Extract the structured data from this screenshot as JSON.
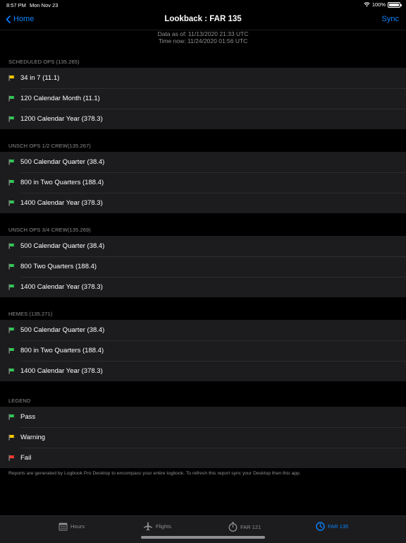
{
  "status": {
    "time": "8:57 PM",
    "date": "Mon Nov 23",
    "battery": "100%"
  },
  "nav": {
    "back_label": "Home",
    "title": "Lookback : FAR 135",
    "sync_label": "Sync"
  },
  "info": {
    "data_as_of": "Data as of: 11/13/2020 21:33 UTC",
    "time_now": "Time now: 11/24/2020 01:56 UTC"
  },
  "colors": {
    "pass": "#34c759",
    "warning": "#ffcc00",
    "fail": "#ff3b30",
    "accent": "#0a84ff"
  },
  "sections": [
    {
      "header": "SCHEDULED OPS (135.265)",
      "rows": [
        {
          "label": "34 in 7 (11.1)",
          "status": "warning"
        },
        {
          "label": "120 Calendar Month (11.1)",
          "status": "pass"
        },
        {
          "label": "1200 Calendar Year (378.3)",
          "status": "pass"
        }
      ]
    },
    {
      "header": "UNSCH OPS 1/2 CREW(135.267)",
      "rows": [
        {
          "label": "500 Calendar Quarter (38.4)",
          "status": "pass"
        },
        {
          "label": "800 in Two Quarters (188.4)",
          "status": "pass"
        },
        {
          "label": "1400 Calendar Year (378.3)",
          "status": "pass"
        }
      ]
    },
    {
      "header": "UNSCH OPS 3/4 CREW(135.269)",
      "rows": [
        {
          "label": "500 Calendar Quarter (38.4)",
          "status": "pass"
        },
        {
          "label": "800 Two Quarters (188.4)",
          "status": "pass"
        },
        {
          "label": "1400 Calendar Year (378.3)",
          "status": "pass"
        }
      ]
    },
    {
      "header": "HEMES (135.271)",
      "rows": [
        {
          "label": "500 Calendar Quarter (38.4)",
          "status": "pass"
        },
        {
          "label": "800 in Two Quarters (188.4)",
          "status": "pass"
        },
        {
          "label": "1400 Calendar Year (378.3)",
          "status": "pass"
        }
      ]
    },
    {
      "header": "LEGEND",
      "rows": [
        {
          "label": "Pass",
          "status": "pass"
        },
        {
          "label": "Warning",
          "status": "warning"
        },
        {
          "label": "Fail",
          "status": "fail"
        }
      ]
    }
  ],
  "footnote": "Reports are generated by Logbook Pro Desktop to encompass your entire logbook. To refresh this report sync your Desktop then this app.",
  "tabs": [
    {
      "label": "Hours",
      "icon": "calendar-icon",
      "active": false
    },
    {
      "label": "Flights",
      "icon": "airplane-icon",
      "active": false
    },
    {
      "label": "FAR 121",
      "icon": "stopwatch-icon",
      "active": false
    },
    {
      "label": "FAR 135",
      "icon": "clock-icon",
      "active": true
    }
  ]
}
